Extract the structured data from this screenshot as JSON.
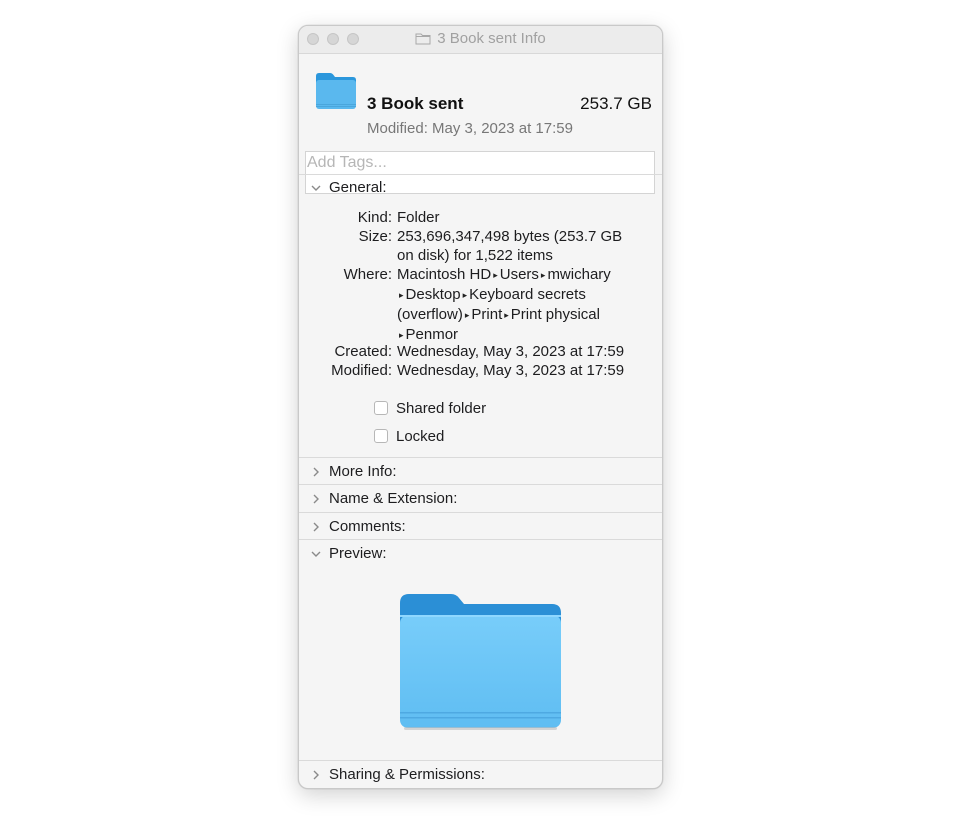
{
  "window": {
    "title": "3 Book sent Info"
  },
  "header": {
    "name": "3 Book sent",
    "size": "253.7 GB",
    "modified": "Modified: May 3, 2023 at 17:59",
    "folder_color": "#5ab8ee"
  },
  "tags": {
    "placeholder": "Add Tags..."
  },
  "general": {
    "label": "General:",
    "kind_key": "Kind:",
    "kind_val": "Folder",
    "size_key": "Size:",
    "size_val_1": "253,696,347,498 bytes (253.7 GB",
    "size_val_2": "on disk) for 1,522 items",
    "where_key": "Where:",
    "where": [
      "Macintosh HD",
      "Users",
      "mwichary",
      "Desktop",
      "Keyboard secrets",
      "(overflow)",
      "Print",
      "Print physical",
      "Penmor"
    ],
    "created_key": "Created:",
    "created_val": "Wednesday, May 3, 2023 at 17:59",
    "modified_key": "Modified:",
    "modified_val": "Wednesday, May 3, 2023 at 17:59",
    "shared_folder": "Shared folder",
    "locked": "Locked"
  },
  "sections": {
    "more_info": "More Info:",
    "name_extension": "Name & Extension:",
    "comments": "Comments:",
    "preview": "Preview:",
    "sharing": "Sharing & Permissions:"
  }
}
